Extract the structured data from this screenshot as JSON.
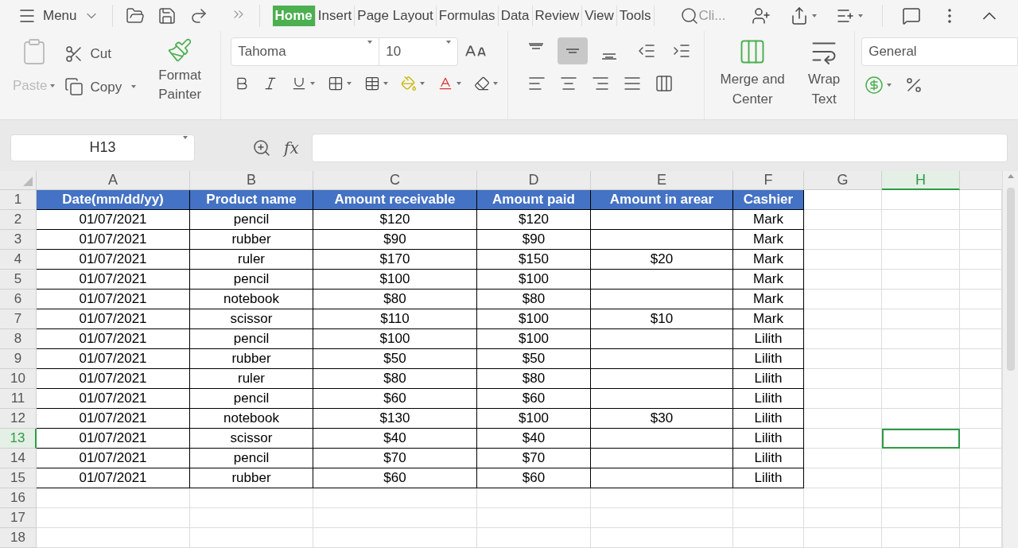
{
  "menu_bar": {
    "menu": {
      "label": "Menu"
    },
    "tabs": [
      {
        "label": "Home",
        "selected": true
      },
      {
        "label": "Insert",
        "selected": false
      },
      {
        "label": "Page Layout",
        "selected": false
      },
      {
        "label": "Formulas",
        "selected": false
      },
      {
        "label": "Data",
        "selected": false
      },
      {
        "label": "Review",
        "selected": false
      },
      {
        "label": "View",
        "selected": false
      },
      {
        "label": "Tools",
        "selected": false
      }
    ],
    "search": {
      "placeholder": "Cli..."
    }
  },
  "ribbon": {
    "paste": {
      "label": "Paste",
      "disabled": true
    },
    "cut": {
      "label": "Cut"
    },
    "copy": {
      "label": "Copy"
    },
    "format_painter": {
      "label": "Format Painter"
    },
    "font": {
      "name": "Tahoma",
      "size": "10"
    },
    "vertical_alignment": [
      {
        "kind": "top",
        "selected": false
      },
      {
        "kind": "middle",
        "selected": true
      },
      {
        "kind": "bottom",
        "selected": false
      }
    ],
    "merge": {
      "label": "Merge and Center"
    },
    "wrap": {
      "label": "Wrap Text"
    },
    "number_format": "General"
  },
  "formula_bar": {
    "name_box": "H13",
    "fx": "fx"
  },
  "sheet": {
    "columns": [
      {
        "letter": "A",
        "selected": false
      },
      {
        "letter": "B",
        "selected": false
      },
      {
        "letter": "C",
        "selected": false
      },
      {
        "letter": "D",
        "selected": false
      },
      {
        "letter": "E",
        "selected": false
      },
      {
        "letter": "F",
        "selected": false
      },
      {
        "letter": "G",
        "selected": false
      },
      {
        "letter": "H",
        "selected": true
      }
    ],
    "header_row": {
      "number": "1",
      "headings": [
        "Date(mm/dd/yy)",
        "Product name",
        "Amount receivable",
        "Amount paid",
        "Amount in arear",
        "Cashier"
      ]
    },
    "rows": [
      {
        "number": "2",
        "selected": false,
        "cells": [
          "01/07/2021",
          "pencil",
          "$120",
          "$120",
          null,
          "Mark"
        ]
      },
      {
        "number": "3",
        "selected": false,
        "cells": [
          "01/07/2021",
          "rubber",
          "$90",
          "$90",
          null,
          "Mark"
        ]
      },
      {
        "number": "4",
        "selected": false,
        "cells": [
          "01/07/2021",
          "ruler",
          "$170",
          "$150",
          "$20",
          "Mark"
        ]
      },
      {
        "number": "5",
        "selected": false,
        "cells": [
          "01/07/2021",
          "pencil",
          "$100",
          "$100",
          null,
          "Mark"
        ]
      },
      {
        "number": "6",
        "selected": false,
        "cells": [
          "01/07/2021",
          "notebook",
          "$80",
          "$80",
          null,
          "Mark"
        ]
      },
      {
        "number": "7",
        "selected": false,
        "cells": [
          "01/07/2021",
          "scissor",
          "$110",
          "$100",
          "$10",
          "Mark"
        ]
      },
      {
        "number": "8",
        "selected": false,
        "cells": [
          "01/07/2021",
          "pencil",
          "$100",
          "$100",
          null,
          "Lilith"
        ]
      },
      {
        "number": "9",
        "selected": false,
        "cells": [
          "01/07/2021",
          "rubber",
          "$50",
          "$50",
          null,
          "Lilith"
        ]
      },
      {
        "number": "10",
        "selected": false,
        "cells": [
          "01/07/2021",
          "ruler",
          "$80",
          "$80",
          null,
          "Lilith"
        ]
      },
      {
        "number": "11",
        "selected": false,
        "cells": [
          "01/07/2021",
          "pencil",
          "$60",
          "$60",
          null,
          "Lilith"
        ]
      },
      {
        "number": "12",
        "selected": false,
        "cells": [
          "01/07/2021",
          "notebook",
          "$130",
          "$100",
          "$30",
          "Lilith"
        ]
      },
      {
        "number": "13",
        "selected": true,
        "cells": [
          "01/07/2021",
          "scissor",
          "$40",
          "$40",
          null,
          "Lilith"
        ]
      },
      {
        "number": "14",
        "selected": false,
        "cells": [
          "01/07/2021",
          "pencil",
          "$70",
          "$70",
          null,
          "Lilith"
        ]
      },
      {
        "number": "15",
        "selected": false,
        "cells": [
          "01/07/2021",
          "rubber",
          "$60",
          "$60",
          null,
          "Lilith"
        ]
      },
      {
        "number": "16",
        "selected": false
      },
      {
        "number": "17",
        "selected": false
      },
      {
        "number": "18",
        "selected": false
      }
    ]
  }
}
